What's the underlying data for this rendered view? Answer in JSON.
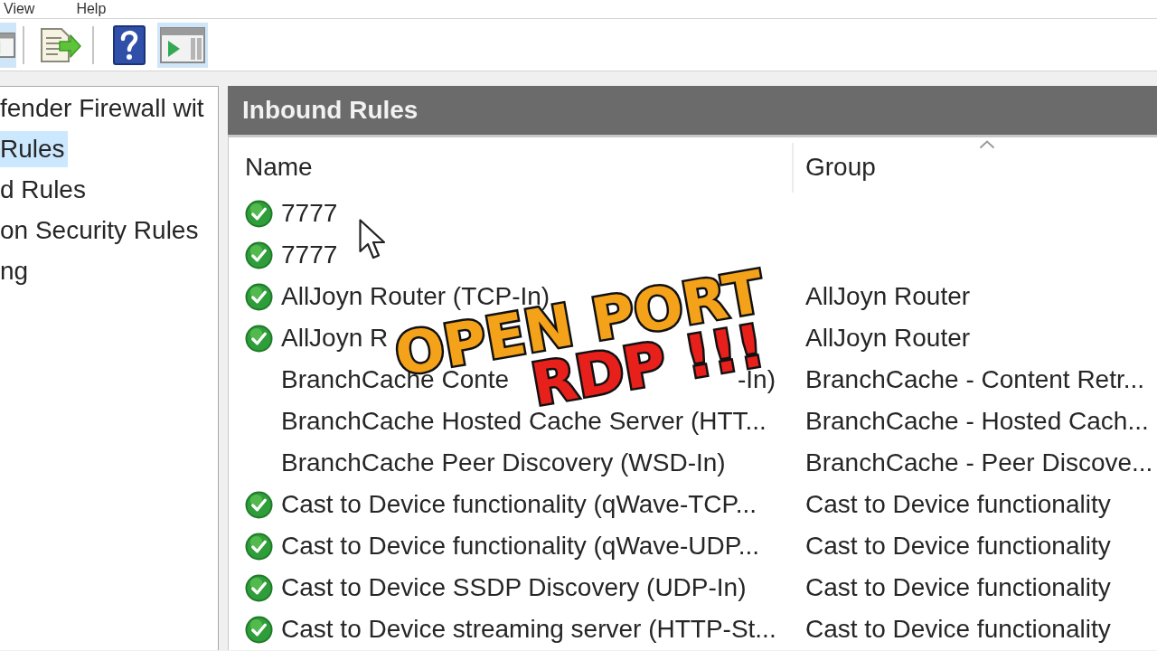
{
  "menu": [
    "View",
    "Help"
  ],
  "toolbar": {
    "groups": [
      [
        {
          "kind": "pane",
          "on": true
        }
      ],
      [
        {
          "kind": "export",
          "on": false
        }
      ],
      [
        {
          "kind": "help",
          "on": false
        },
        {
          "kind": "action-pane",
          "on": true
        }
      ]
    ]
  },
  "tree": [
    {
      "label": "fender Firewall wit",
      "selected": false,
      "children": [
        {
          "label": "Rules",
          "selected": true
        },
        {
          "label": "d Rules",
          "selected": false
        },
        {
          "label": "on Security Rules",
          "selected": false
        },
        {
          "label": "ng",
          "selected": false
        }
      ]
    }
  ],
  "pane": {
    "title": "Inbound Rules"
  },
  "rules": {
    "columns": [
      {
        "label": "Name",
        "sorted": false
      },
      {
        "label": "Group",
        "sorted": true
      }
    ],
    "rows": [
      {
        "enabled": true,
        "name": "7777"
      },
      {
        "enabled": true,
        "name": "7777"
      },
      {
        "enabled": true,
        "name": "AllJoyn Router (TCP-In)",
        "group": "AllJoyn Router"
      },
      {
        "enabled": true,
        "name": "AllJoyn R",
        "group": "AllJoyn Router"
      },
      {
        "enabled": false,
        "name": "BranchCache Conte",
        "name_end": "-In)",
        "group": "BranchCache - Content Retr..."
      },
      {
        "enabled": false,
        "name": "BranchCache Hosted Cache Server (HTT...",
        "group": "BranchCache - Hosted Cach..."
      },
      {
        "enabled": false,
        "name": "BranchCache Peer Discovery (WSD-In)",
        "group": "BranchCache - Peer Discove..."
      },
      {
        "enabled": true,
        "name": "Cast to Device functionality (qWave-TCP...",
        "group": "Cast to Device functionality"
      },
      {
        "enabled": true,
        "name": "Cast to Device functionality (qWave-UDP...",
        "group": "Cast to Device functionality"
      },
      {
        "enabled": true,
        "name": "Cast to Device SSDP Discovery (UDP-In)",
        "group": "Cast to Device functionality"
      },
      {
        "enabled": true,
        "name": "Cast to Device streaming server (HTTP-St...",
        "group": "Cast to Device functionality"
      }
    ]
  },
  "caption": {
    "lines": [
      {
        "text": "OPEN PORT",
        "color": "#f5a21b"
      },
      {
        "text": "RDP !!!",
        "color": "#e8201b"
      }
    ]
  }
}
